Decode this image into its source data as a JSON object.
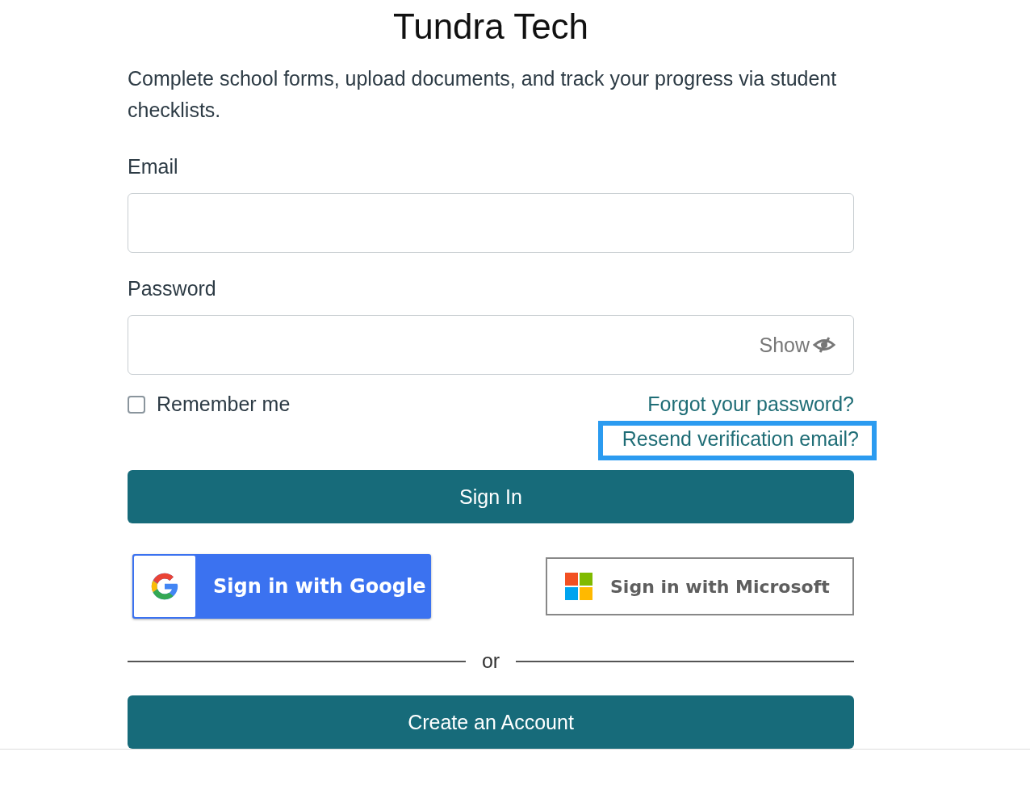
{
  "title": "Tundra Tech",
  "description": "Complete school forms, upload documents, and track your progress via student checklists.",
  "email": {
    "label": "Email"
  },
  "password": {
    "label": "Password",
    "toggle": "Show"
  },
  "remember": {
    "label": "Remember me",
    "checked": false
  },
  "links": [
    {
      "label": "Forgot your password?",
      "focused": false
    },
    {
      "label": "Resend verification email?",
      "focused": true
    }
  ],
  "sign_in": "Sign In",
  "social": [
    {
      "kind": "google",
      "label": "Sign in with Google"
    },
    {
      "kind": "microsoft",
      "label": "Sign in with Microsoft"
    }
  ],
  "divider": "or",
  "create_account": "Create an Account"
}
